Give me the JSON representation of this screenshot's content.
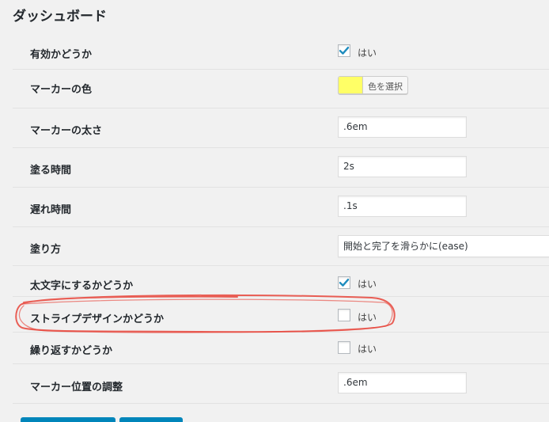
{
  "page": {
    "title": "ダッシュボード"
  },
  "settings": {
    "enabled": {
      "label": "有効かどうか",
      "checked": true,
      "checkbox_label": "はい"
    },
    "marker_color": {
      "label": "マーカーの色",
      "button_label": "色を選択",
      "color": "#ffff66"
    },
    "marker_thickness": {
      "label": "マーカーの太さ",
      "value": ".6em"
    },
    "paint_time": {
      "label": "塗る時間",
      "value": "2s"
    },
    "delay_time": {
      "label": "遅れ時間",
      "value": ".1s"
    },
    "paint_style": {
      "label": "塗り方",
      "value": "開始と完了を滑らかに(ease)"
    },
    "bold": {
      "label": "太文字にするかどうか",
      "checked": true,
      "checkbox_label": "はい"
    },
    "stripe": {
      "label": "ストライプデザインかどうか",
      "checked": false,
      "checkbox_label": "はい"
    },
    "repeat": {
      "label": "繰り返すかどうか",
      "checked": false,
      "checkbox_label": "はい"
    },
    "marker_position": {
      "label": "マーカー位置の調整",
      "value": ".6em"
    }
  },
  "colors": {
    "accent": "#1e8cbe",
    "highlight_stroke": "#e8443a",
    "primary_button": "#0085ba"
  }
}
